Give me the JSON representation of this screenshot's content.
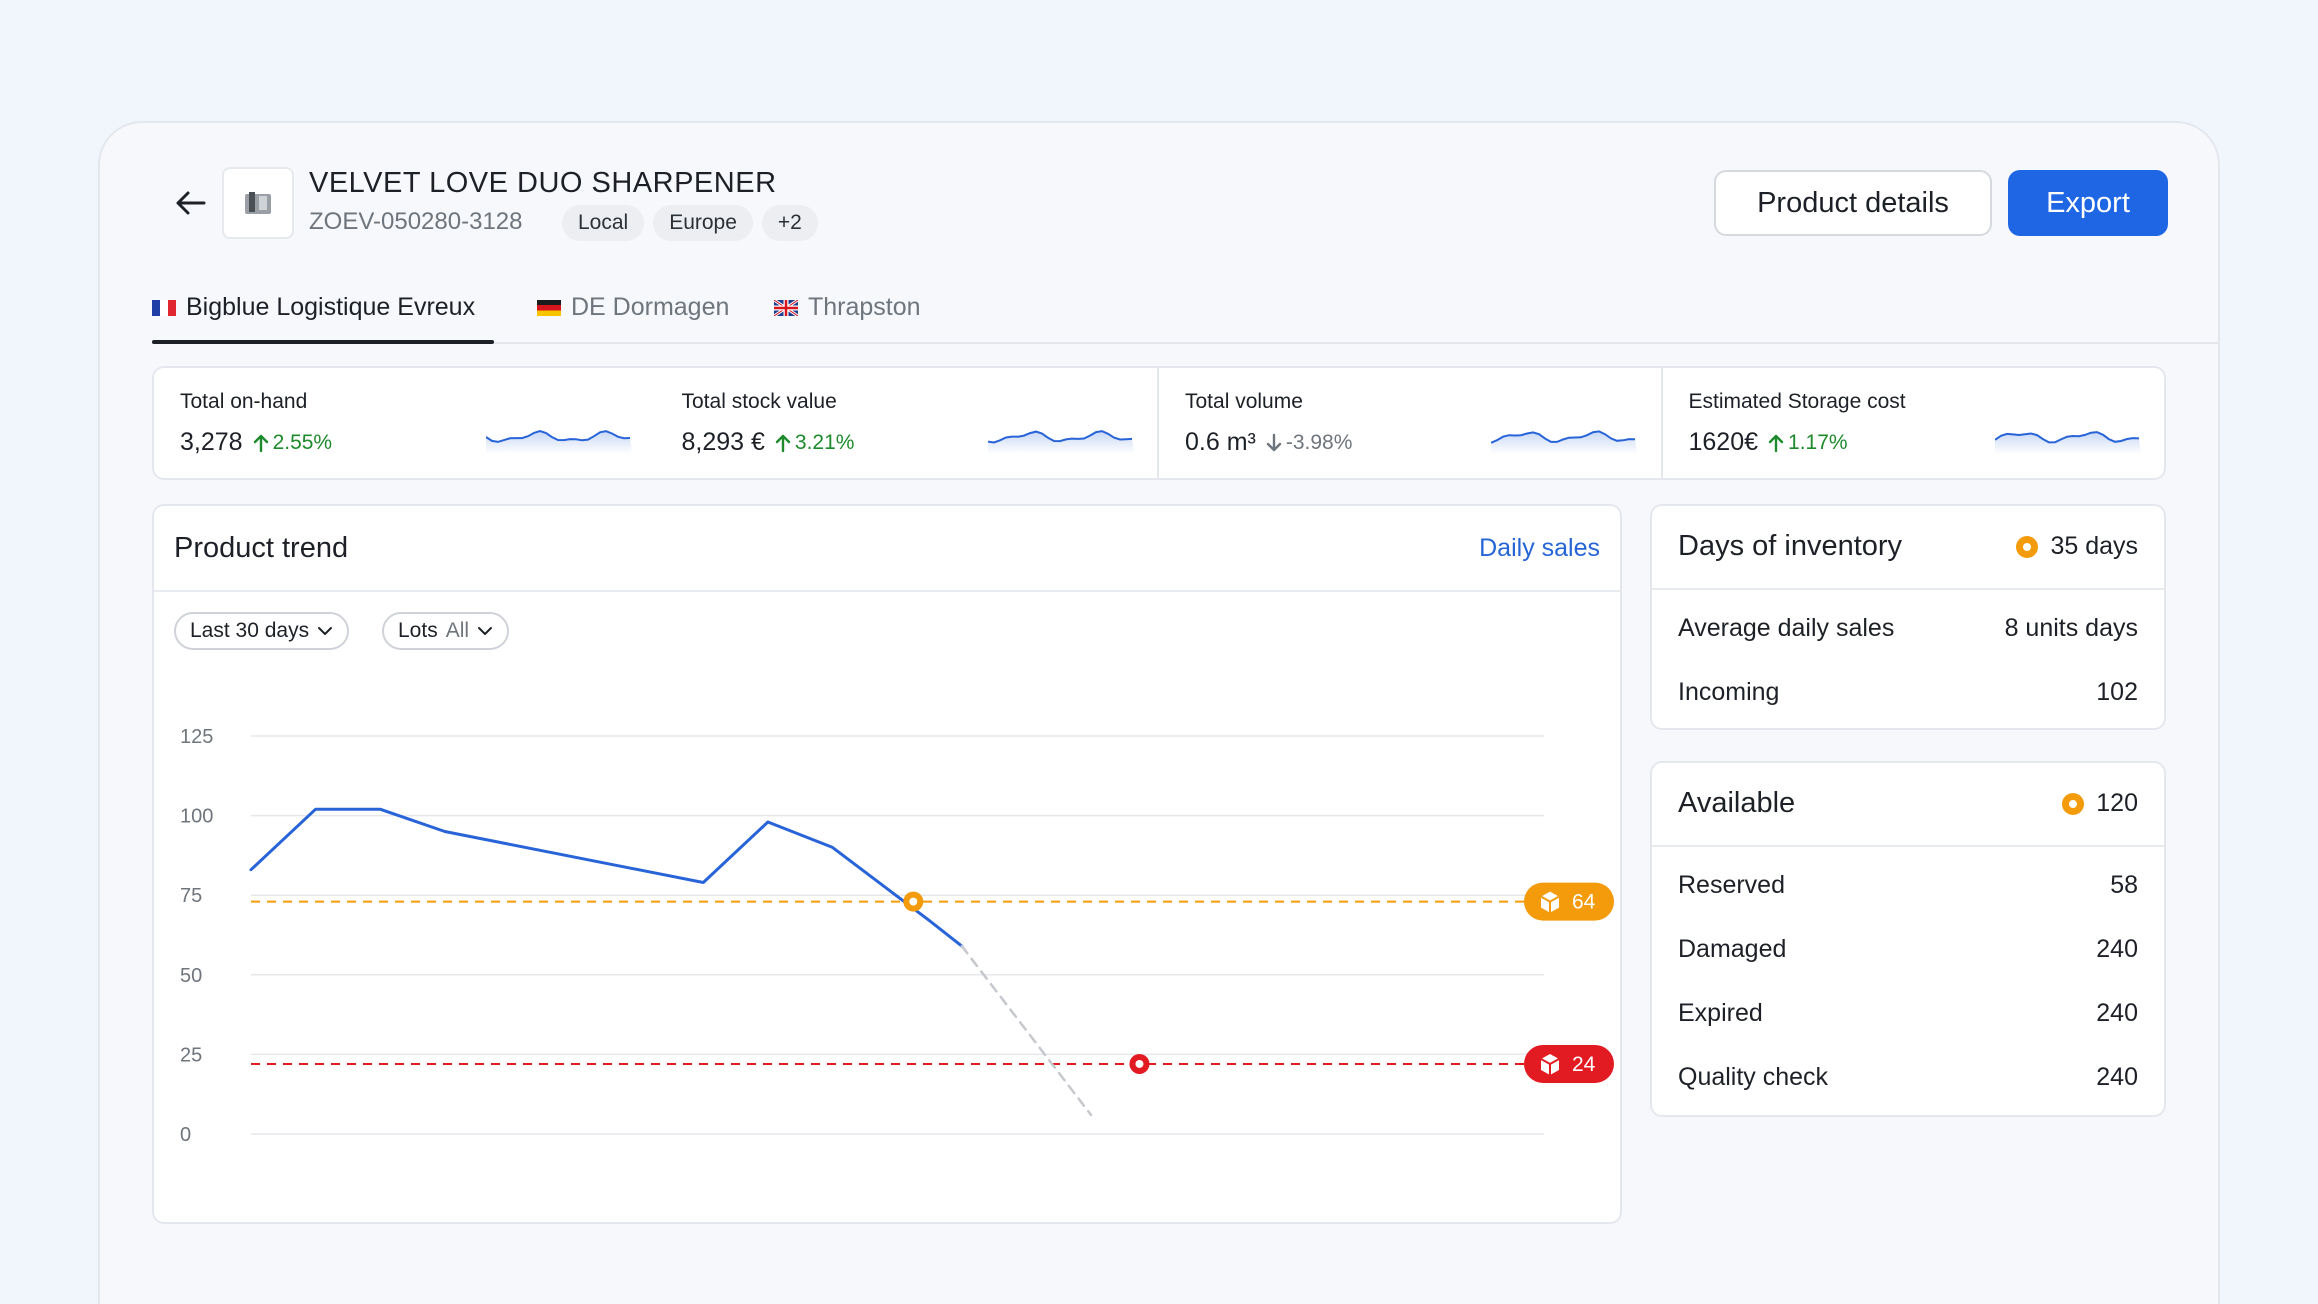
{
  "header": {
    "title": "VELVET LOVE DUO SHARPENER",
    "sku": "ZOEV-050280-3128",
    "tags": [
      "Local",
      "Europe",
      "+2"
    ],
    "details_label": "Product details",
    "export_label": "Export"
  },
  "tabs": [
    {
      "label": "Bigblue Logistique Evreux",
      "flag": "FR",
      "active": true
    },
    {
      "label": "DE Dormagen",
      "flag": "DE",
      "active": false
    },
    {
      "label": "Thrapston",
      "flag": "GB",
      "active": false
    }
  ],
  "stats": [
    {
      "label": "Total on-hand",
      "value": "3,278",
      "delta": "2.55%",
      "direction": "up"
    },
    {
      "label": "Total stock value",
      "value": "8,293 €",
      "delta": "3.21%",
      "direction": "up"
    },
    {
      "label": "Total volume",
      "value": "0.6 m³",
      "delta": "-3.98%",
      "direction": "down"
    },
    {
      "label": "Estimated Storage cost",
      "value": "1620€",
      "delta": "1.17%",
      "direction": "up"
    }
  ],
  "trend": {
    "title": "Product trend",
    "link": "Daily sales",
    "filter_period": "Last 30 days",
    "filter_lots_label": "Lots",
    "filter_lots_value": "All"
  },
  "chart_data": {
    "type": "line",
    "y_ticks": [
      0,
      25,
      50,
      75,
      100,
      125
    ],
    "ylim": [
      0,
      125
    ],
    "xlim": [
      0,
      26
    ],
    "grid": true,
    "series": [
      {
        "style": "solid",
        "color": "#2864d8",
        "points": [
          [
            0,
            83
          ],
          [
            2,
            102
          ],
          [
            4,
            102
          ],
          [
            6,
            95
          ],
          [
            14,
            79
          ],
          [
            16,
            98
          ],
          [
            18,
            90
          ],
          [
            21,
            67
          ],
          [
            22,
            59
          ]
        ]
      },
      {
        "style": "dashed",
        "color": "#c5c8cd",
        "points": [
          [
            22,
            59
          ],
          [
            26,
            6
          ]
        ]
      }
    ],
    "thresholds": [
      {
        "value": 73,
        "color": "#f49b0b",
        "label": "64",
        "marker_x": 20.5
      },
      {
        "value": 22,
        "color": "#e21b23",
        "label": "24",
        "marker_x": 27.5
      }
    ]
  },
  "days_inventory": {
    "title": "Days of inventory",
    "value": "35 days",
    "rows": [
      {
        "label": "Average daily sales",
        "value": "8 units days"
      },
      {
        "label": "Incoming",
        "value": "102"
      }
    ]
  },
  "available": {
    "title": "Available",
    "value": "120",
    "rows": [
      {
        "label": "Reserved",
        "value": "58"
      },
      {
        "label": "Damaged",
        "value": "240"
      },
      {
        "label": "Expired",
        "value": "240"
      },
      {
        "label": "Quality check",
        "value": "240"
      }
    ]
  },
  "colors": {
    "accent": "#1f66e5",
    "up": "#1e8a2c",
    "warning": "#f49b0b",
    "danger": "#e21b23",
    "line": "#2864d8"
  }
}
